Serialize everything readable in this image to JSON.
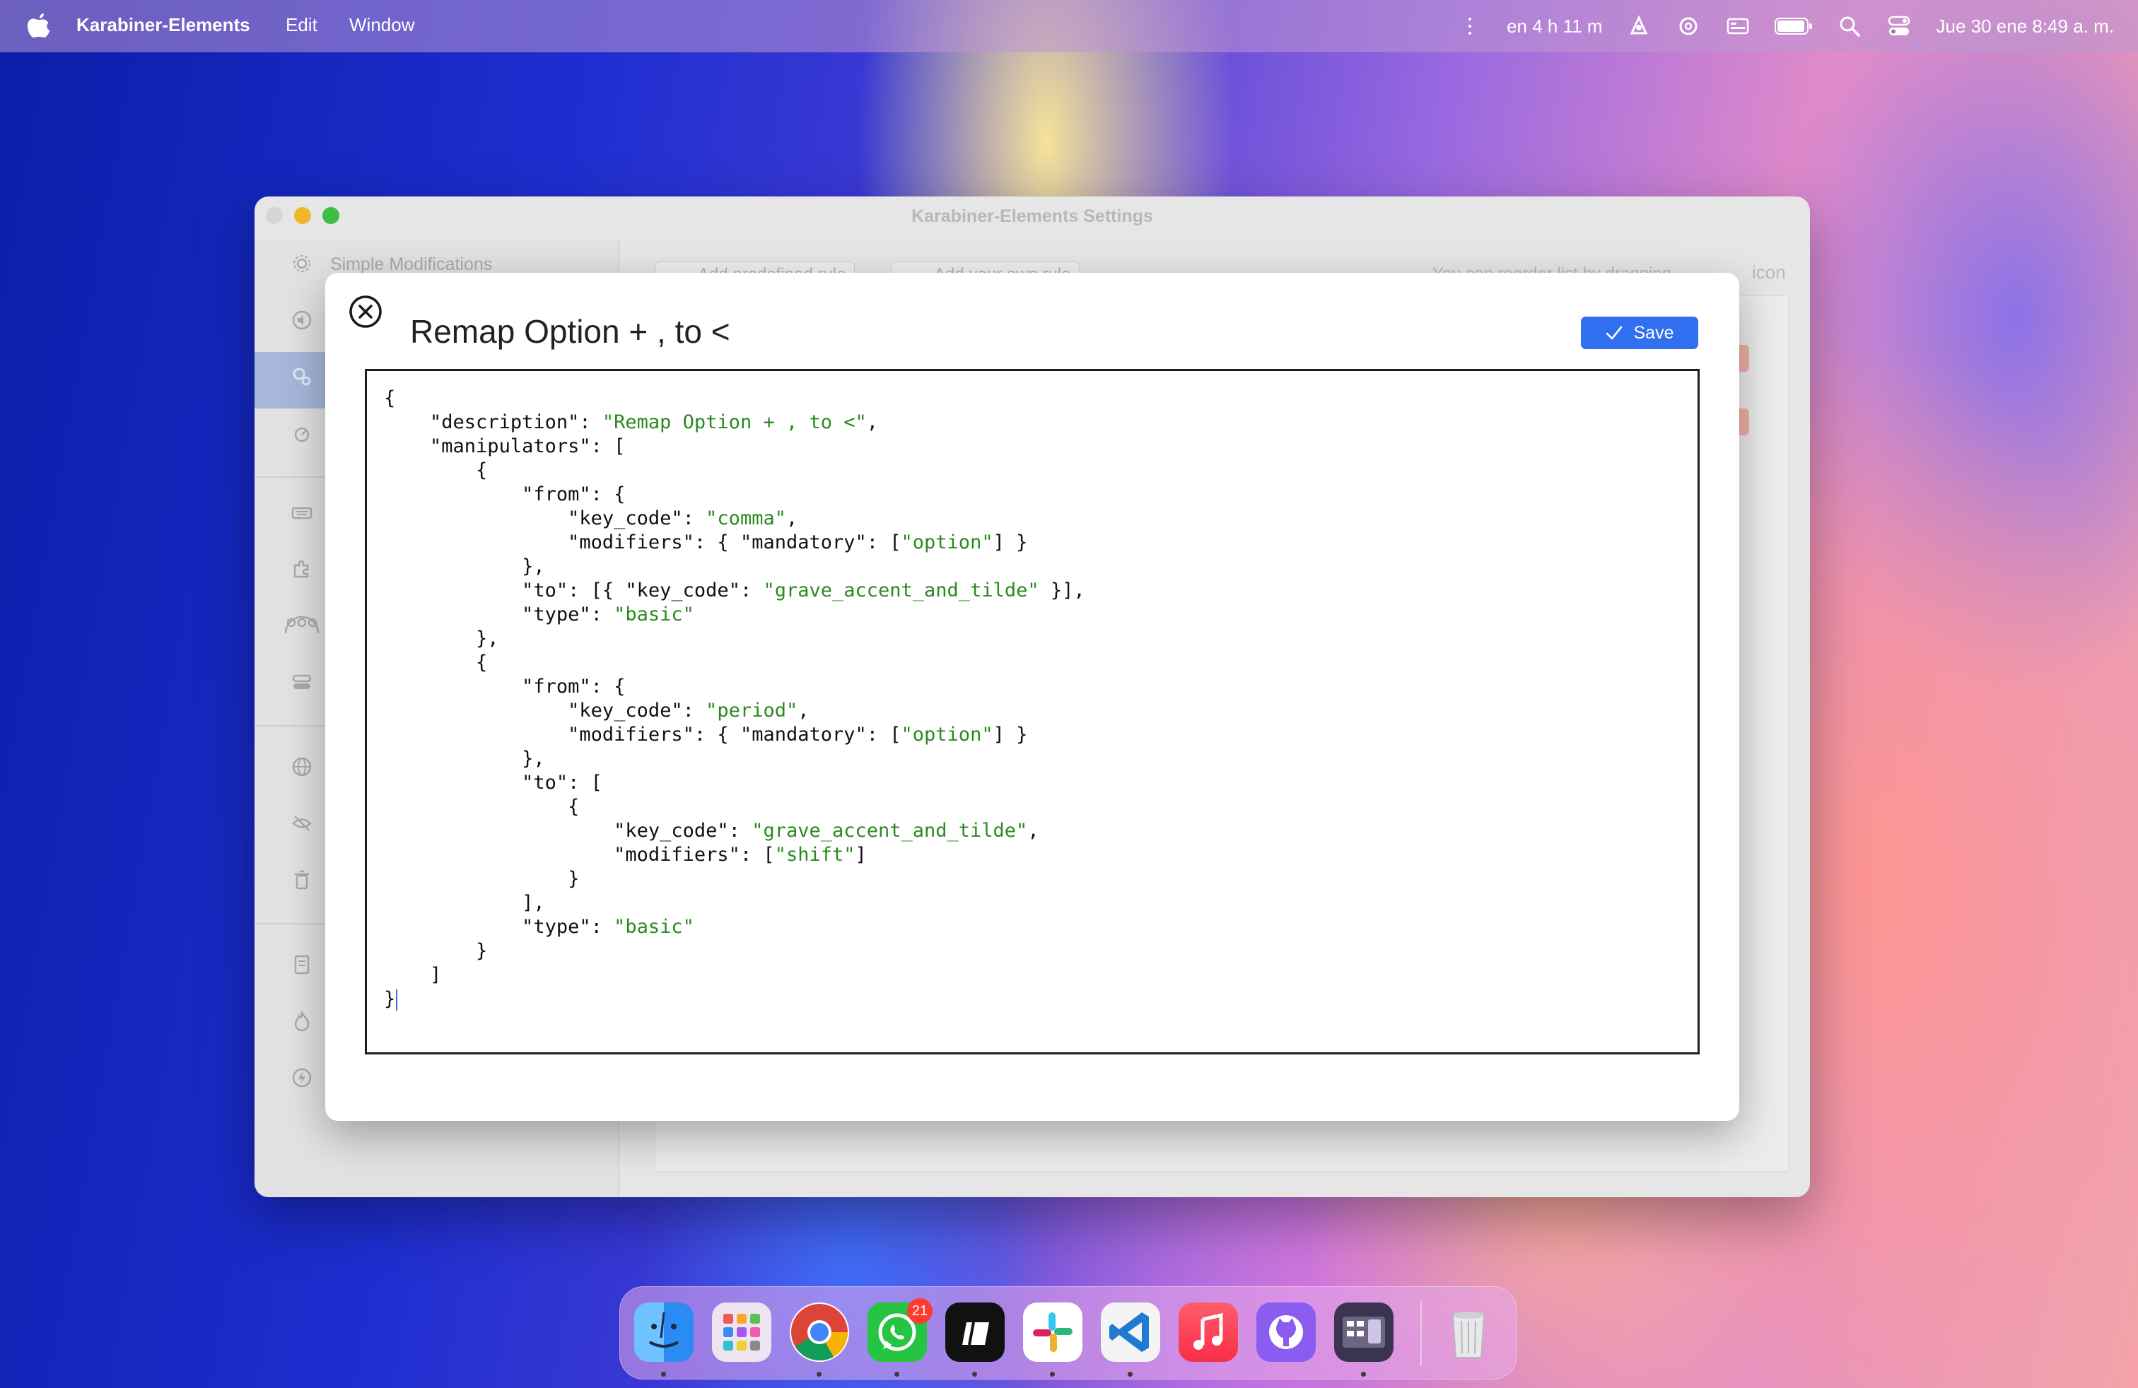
{
  "menubar": {
    "app_name": "Karabiner-Elements",
    "menus": [
      "Edit",
      "Window"
    ],
    "battery_time": "en 4 h 11 m",
    "datetime": "Jue 30 ene  8:49 a. m."
  },
  "settings_window": {
    "title": "Karabiner-Elements Settings",
    "sidebar_first_item": "Simple Modifications",
    "toolbar": {
      "add_predefined_rule": "Add predefined rule",
      "add_own_rule": "Add your own rule",
      "reorder_hint": "You can reorder list by dragging",
      "icon_label": "icon"
    }
  },
  "dialog": {
    "title": "Remap Option + , to <",
    "save_label": "Save",
    "code_lines": [
      "{",
      "    \"description\": \"Remap Option + , to <\",",
      "    \"manipulators\": [",
      "        {",
      "            \"from\": {",
      "                \"key_code\": \"comma\",",
      "                \"modifiers\": { \"mandatory\": [\"option\"] }",
      "            },",
      "            \"to\": [{ \"key_code\": \"grave_accent_and_tilde\" }],",
      "            \"type\": \"basic\"",
      "        },",
      "        {",
      "            \"from\": {",
      "                \"key_code\": \"period\",",
      "                \"modifiers\": { \"mandatory\": [\"option\"] }",
      "            },",
      "            \"to\": [",
      "                {",
      "                    \"key_code\": \"grave_accent_and_tilde\",",
      "                    \"modifiers\": [\"shift\"]",
      "                }",
      "            ],",
      "            \"type\": \"basic\"",
      "        }",
      "    ]",
      "}"
    ]
  },
  "dock": {
    "whatsapp_badge": "21"
  },
  "colors": {
    "accent": "#2f6ff0",
    "string": "#2a8a1e",
    "sidebar_selected": "#a6b7da"
  }
}
